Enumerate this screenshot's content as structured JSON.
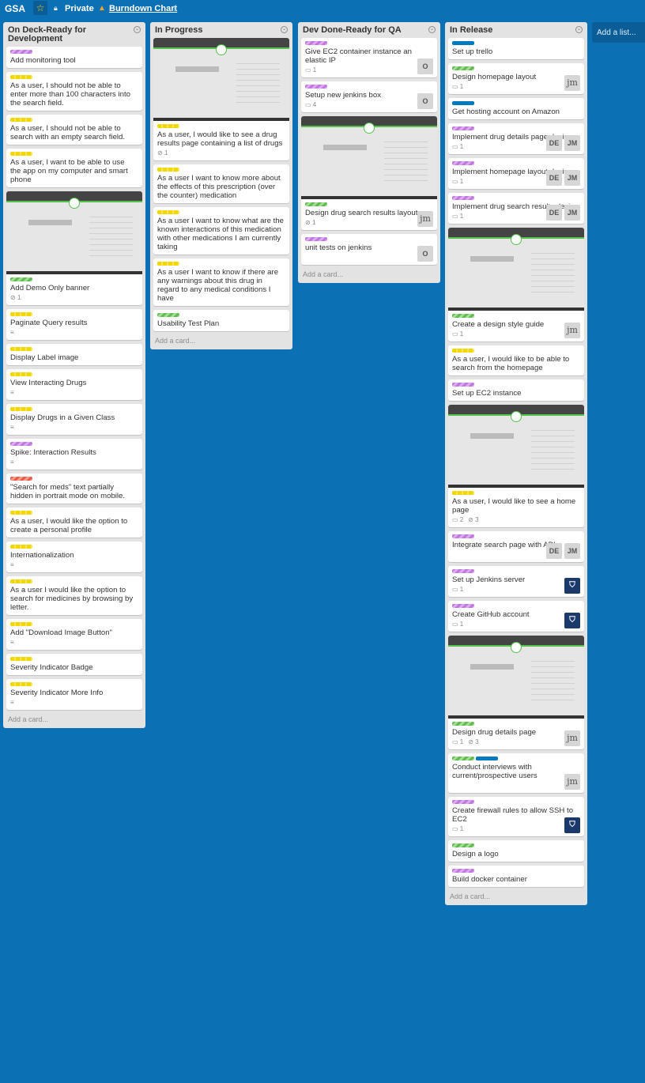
{
  "topbar": {
    "board_name": "GSA",
    "privacy": "Private",
    "burndown": "Burndown Chart"
  },
  "add_list": "Add a list...",
  "add_card": "Add a card...",
  "lists": [
    {
      "title": "On Deck-Ready for Development",
      "cards": [
        {
          "labels": [
            "purple"
          ],
          "title": "Add monitoring tool"
        },
        {
          "labels": [
            "yellow"
          ],
          "title": "As a user, I should not be able to enter more than 100 characters into the search field."
        },
        {
          "labels": [
            "yellow"
          ],
          "title": "As a user, I should not be able to search with an empty search field."
        },
        {
          "labels": [
            "yellow"
          ],
          "title": "As a user, I want to be able to use the app on my computer and smart phone"
        },
        {
          "cover": "homepage",
          "labels": [
            "green"
          ],
          "title": "Add Demo Only banner",
          "attachments": "1"
        },
        {
          "labels": [
            "yellow"
          ],
          "title": "Paginate Query results",
          "desc": true
        },
        {
          "labels": [
            "yellow"
          ],
          "title": "Display Label image"
        },
        {
          "labels": [
            "yellow"
          ],
          "title": "View Interacting Drugs",
          "desc": true
        },
        {
          "labels": [
            "yellow"
          ],
          "title": "Display Drugs in a Given Class",
          "desc": true
        },
        {
          "labels": [
            "purple"
          ],
          "title": "Spike: Interaction Results",
          "desc": true
        },
        {
          "labels": [
            "red"
          ],
          "title": "\"Search for meds\" text partially hidden in portrait mode on mobile."
        },
        {
          "labels": [
            "yellow"
          ],
          "title": "As a user, I would like the option to create a personal profile"
        },
        {
          "labels": [
            "yellow"
          ],
          "title": "Internationalization",
          "desc": true
        },
        {
          "labels": [
            "yellow"
          ],
          "title": "As a user I would like the option to search for medicines by browsing by letter."
        },
        {
          "labels": [
            "yellow"
          ],
          "title": "Add \"Download Image Button\"",
          "desc": true
        },
        {
          "labels": [
            "yellow"
          ],
          "title": "Severity Indicator Badge"
        },
        {
          "labels": [
            "yellow"
          ],
          "title": "Severity Indicator More Info",
          "desc": true
        }
      ]
    },
    {
      "title": "In Progress",
      "cards": [
        {
          "cover": "results",
          "labels": [
            "yellow"
          ],
          "title": "As a user, I would like to see a drug results page containing a list of drugs",
          "attachments": "1"
        },
        {
          "labels": [
            "yellow"
          ],
          "title": "As a user I want to know more about the effects of this prescription (over the counter) medication"
        },
        {
          "labels": [
            "yellow"
          ],
          "title": "As a user I want to know what are the known interactions of this medication with other medications I am currently taking"
        },
        {
          "labels": [
            "yellow"
          ],
          "title": "As a user I want to know if there are any warnings about this drug in regard to any medical conditions I have"
        },
        {
          "labels": [
            "green"
          ],
          "title": "Usability Test Plan"
        }
      ]
    },
    {
      "title": "Dev Done-Ready for QA",
      "cards": [
        {
          "labels": [
            "purple"
          ],
          "title": "Give EC2 container instance an elastic IP",
          "comments": "1",
          "members": [
            "O"
          ]
        },
        {
          "labels": [
            "purple"
          ],
          "title": "Setup new jenkins box",
          "comments": "4",
          "members": [
            "O"
          ]
        },
        {
          "cover": "mobile",
          "labels": [
            "green"
          ],
          "title": "Design drug search results layout",
          "attachments": "1",
          "members": [
            "jm"
          ]
        },
        {
          "labels": [
            "purple"
          ],
          "title": "unit tests on jenkins",
          "members": [
            "O"
          ]
        }
      ]
    },
    {
      "title": "In Release",
      "cards": [
        {
          "labels": [
            "blue"
          ],
          "title": "Set up trello"
        },
        {
          "labels": [
            "green"
          ],
          "title": "Design homepage layout",
          "comments": "1",
          "members": [
            "jm"
          ]
        },
        {
          "labels": [
            "blue"
          ],
          "title": "Get hosting account on Amazon"
        },
        {
          "labels": [
            "purple"
          ],
          "title": "Implement drug details page design",
          "comments": "1",
          "members": [
            "DE",
            "JM"
          ]
        },
        {
          "labels": [
            "purple"
          ],
          "title": "Implement homepage layout design",
          "comments": "1",
          "members": [
            "DE",
            "JM"
          ]
        },
        {
          "labels": [
            "purple"
          ],
          "title": "Implement drug search results design",
          "comments": "1",
          "members": [
            "DE",
            "JM"
          ]
        },
        {
          "cover": "styleguide",
          "labels": [
            "green"
          ],
          "title": "Create a design style guide",
          "comments": "1",
          "members": [
            "jm"
          ]
        },
        {
          "labels": [
            "yellow"
          ],
          "title": "As a user, I would like to be able to search from the homepage"
        },
        {
          "labels": [
            "purple"
          ],
          "title": "Set up EC2 instance"
        },
        {
          "cover": "homepage",
          "labels": [
            "yellow"
          ],
          "title": "As a user, I would like to see a home page",
          "comments": "2",
          "attachments": "3"
        },
        {
          "labels": [
            "purple"
          ],
          "title": "Integrate search page with API",
          "members": [
            "DE",
            "JM"
          ]
        },
        {
          "labels": [
            "purple"
          ],
          "title": "Set up Jenkins server",
          "comments": "1",
          "members": [
            "shield"
          ]
        },
        {
          "labels": [
            "purple"
          ],
          "title": "Create GitHub account",
          "comments": "1",
          "members": [
            "shield"
          ]
        },
        {
          "cover": "details",
          "labels": [
            "green"
          ],
          "title": "Design drug details page",
          "comments": "1",
          "attachments": "3",
          "members": [
            "jm"
          ]
        },
        {
          "labels": [
            "green",
            "blue"
          ],
          "title": "Conduct interviews with current/prospective users",
          "members": [
            "jm"
          ]
        },
        {
          "labels": [
            "purple"
          ],
          "title": "Create firewall rules to allow SSH to EC2",
          "comments": "1",
          "members": [
            "shield"
          ]
        },
        {
          "labels": [
            "green"
          ],
          "title": "Design a logo"
        },
        {
          "labels": [
            "purple"
          ],
          "title": "Build docker container"
        }
      ]
    }
  ]
}
